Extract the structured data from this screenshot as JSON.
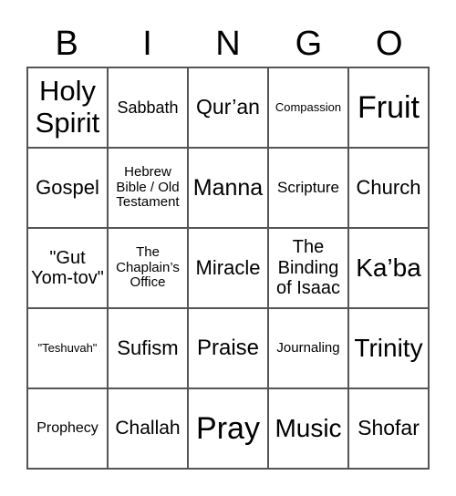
{
  "header": [
    "B",
    "I",
    "N",
    "G",
    "O"
  ],
  "cells": [
    "Holy Spirit",
    "Sabbath",
    "Qur’an",
    "Compassion",
    "Fruit",
    "Gospel",
    "Hebrew Bible / Old Testament",
    "Manna",
    "Scripture",
    "Church",
    "\"Gut Yom-tov\"",
    "The Chaplain’s Office",
    "Miracle",
    "The Binding of Isaac",
    "Ka’ba",
    "\"Teshuvah\"",
    "Sufism",
    "Praise",
    "Journaling",
    "Trinity",
    "Prophecy",
    "Challah",
    "Pray",
    "Music",
    "Shofar"
  ]
}
